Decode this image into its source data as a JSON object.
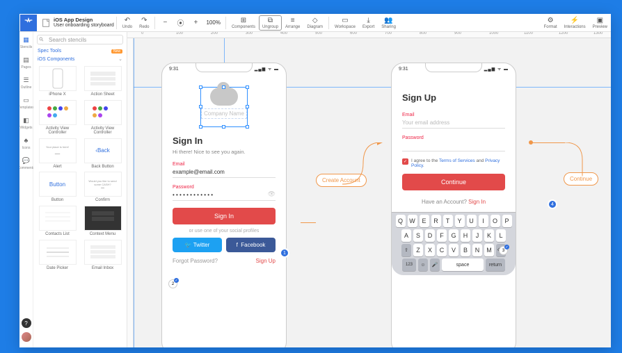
{
  "doc": {
    "title": "iOS App Design",
    "subtitle": "User onboarding storyboard"
  },
  "toolbar": {
    "undo": "Undo",
    "redo": "Redo",
    "zoom": "100%",
    "components": "Components",
    "ungroup": "Ungroup",
    "arrange": "Arrange",
    "diagram": "Diagram",
    "workspace": "Workspace",
    "export": "Export",
    "sharing": "Sharing",
    "format": "Format",
    "interactions": "Interactions",
    "preview": "Preview"
  },
  "ruler_marks": [
    "0",
    "100",
    "200",
    "300",
    "400",
    "500",
    "600",
    "700",
    "800",
    "900",
    "1000",
    "1100",
    "1200",
    "1300"
  ],
  "left_icons": [
    "Stencils",
    "Pages",
    "Outline",
    "Templates",
    "Widgets",
    "Icons",
    "Comments"
  ],
  "stencils": {
    "search_placeholder": "Search stencils",
    "section1": "Spec Tools",
    "section2": "iOS Components",
    "items": [
      {
        "label": "iPhone X"
      },
      {
        "label": "Action Sheet"
      },
      {
        "label": "Activity View Controller"
      },
      {
        "label": "Activity View Controller"
      },
      {
        "label": "Alert"
      },
      {
        "label": "Back Button"
      },
      {
        "label": "Button"
      },
      {
        "label": "Confirm"
      },
      {
        "label": "Contacts List"
      },
      {
        "label": "Context Menu"
      },
      {
        "label": "Date Picker"
      },
      {
        "label": "Email Inbox"
      }
    ],
    "back_btn_text": "Back",
    "button_text": "Button"
  },
  "phone1": {
    "time": "9:31",
    "company": "Company Name",
    "heading": "Sign In",
    "sub": "Hi there! Nice to see you again.",
    "email_lbl": "Email",
    "email_val": "example@email.com",
    "pwd_lbl": "Password",
    "pwd_val": "• • • • • • • • • • • •",
    "btn": "Sign In",
    "or": "or use one of your social profiles",
    "twitter": "Twitter",
    "facebook": "Facebook",
    "forgot": "Forgot Password?",
    "signup": "Sign Up"
  },
  "phone2": {
    "time": "9:31",
    "heading": "Sign Up",
    "email_lbl": "Email",
    "email_ph": "Your email address",
    "pwd_lbl": "Password",
    "terms_pre": "I agree to the ",
    "terms1": "Terms of Services",
    "terms_mid": " and ",
    "terms2": "Privacy Policy",
    "terms_end": ".",
    "btn": "Continue",
    "has": "Have an Account? ",
    "signin": "Sign In"
  },
  "keyboard": {
    "r1": [
      "Q",
      "W",
      "E",
      "R",
      "T",
      "Y",
      "U",
      "I",
      "O",
      "P"
    ],
    "r2": [
      "A",
      "S",
      "D",
      "F",
      "G",
      "H",
      "J",
      "K",
      "L"
    ],
    "r3": [
      "Z",
      "X",
      "C",
      "V",
      "B",
      "N",
      "M"
    ],
    "space": "space",
    "return": "return",
    "n123": "123"
  },
  "flow": {
    "create": "Create Account",
    "continue": "Continue",
    "b1": "1",
    "b2": "2",
    "b3": "3",
    "b4": "4"
  }
}
